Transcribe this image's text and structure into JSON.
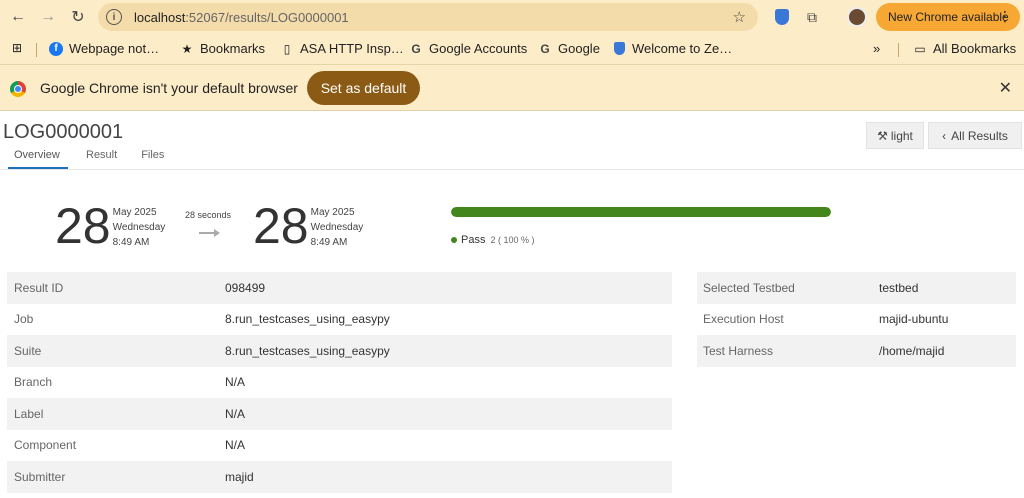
{
  "browser": {
    "url_host": "localhost",
    "url_path": ":52067/results/LOG0000001",
    "update_label": "New Chrome available",
    "bookmarks": [
      {
        "label": "Webpage not…",
        "icon": "facebook-icon"
      },
      {
        "label": "Bookmarks",
        "icon": "star-icon"
      },
      {
        "label": "ASA HTTP Insp…",
        "icon": "page-icon"
      },
      {
        "label": "Google Accounts",
        "icon": "google-icon"
      },
      {
        "label": "Google",
        "icon": "google-icon"
      },
      {
        "label": "Welcome to Ze…",
        "icon": "shield-icon"
      }
    ],
    "all_bookmarks_label": "All Bookmarks",
    "infobar_message": "Google Chrome isn't your default browser",
    "infobar_button": "Set as default"
  },
  "page": {
    "title": "LOG0000001",
    "tabs": [
      {
        "label": "Overview",
        "active": true
      },
      {
        "label": "Result",
        "active": false
      },
      {
        "label": "Files",
        "active": false
      }
    ],
    "theme_button": "light",
    "back_button": "All Results"
  },
  "timing": {
    "start": {
      "day": "28",
      "month_year": "May 2025",
      "weekday": "Wednesday",
      "time": "8:49 AM"
    },
    "duration": "28 seconds",
    "end": {
      "day": "28",
      "month_year": "May 2025",
      "weekday": "Wednesday",
      "time": "8:49 AM"
    }
  },
  "results": {
    "pass_fraction": 1.0,
    "pass_label": "Pass",
    "pass_count": "2 ( 100 % )",
    "pass_color": "#43871c"
  },
  "details_left": [
    {
      "key": "Result ID",
      "value": "098499"
    },
    {
      "key": "Job",
      "value": "8.run_testcases_using_easypy"
    },
    {
      "key": "Suite",
      "value": "8.run_testcases_using_easypy"
    },
    {
      "key": "Branch",
      "value": "N/A"
    },
    {
      "key": "Label",
      "value": "N/A"
    },
    {
      "key": "Component",
      "value": "N/A"
    },
    {
      "key": "Submitter",
      "value": "majid"
    }
  ],
  "details_right": [
    {
      "key": "Selected Testbed",
      "value": "testbed"
    },
    {
      "key": "Execution Host",
      "value": "majid-ubuntu"
    },
    {
      "key": "Test Harness",
      "value": "/home/majid"
    }
  ]
}
